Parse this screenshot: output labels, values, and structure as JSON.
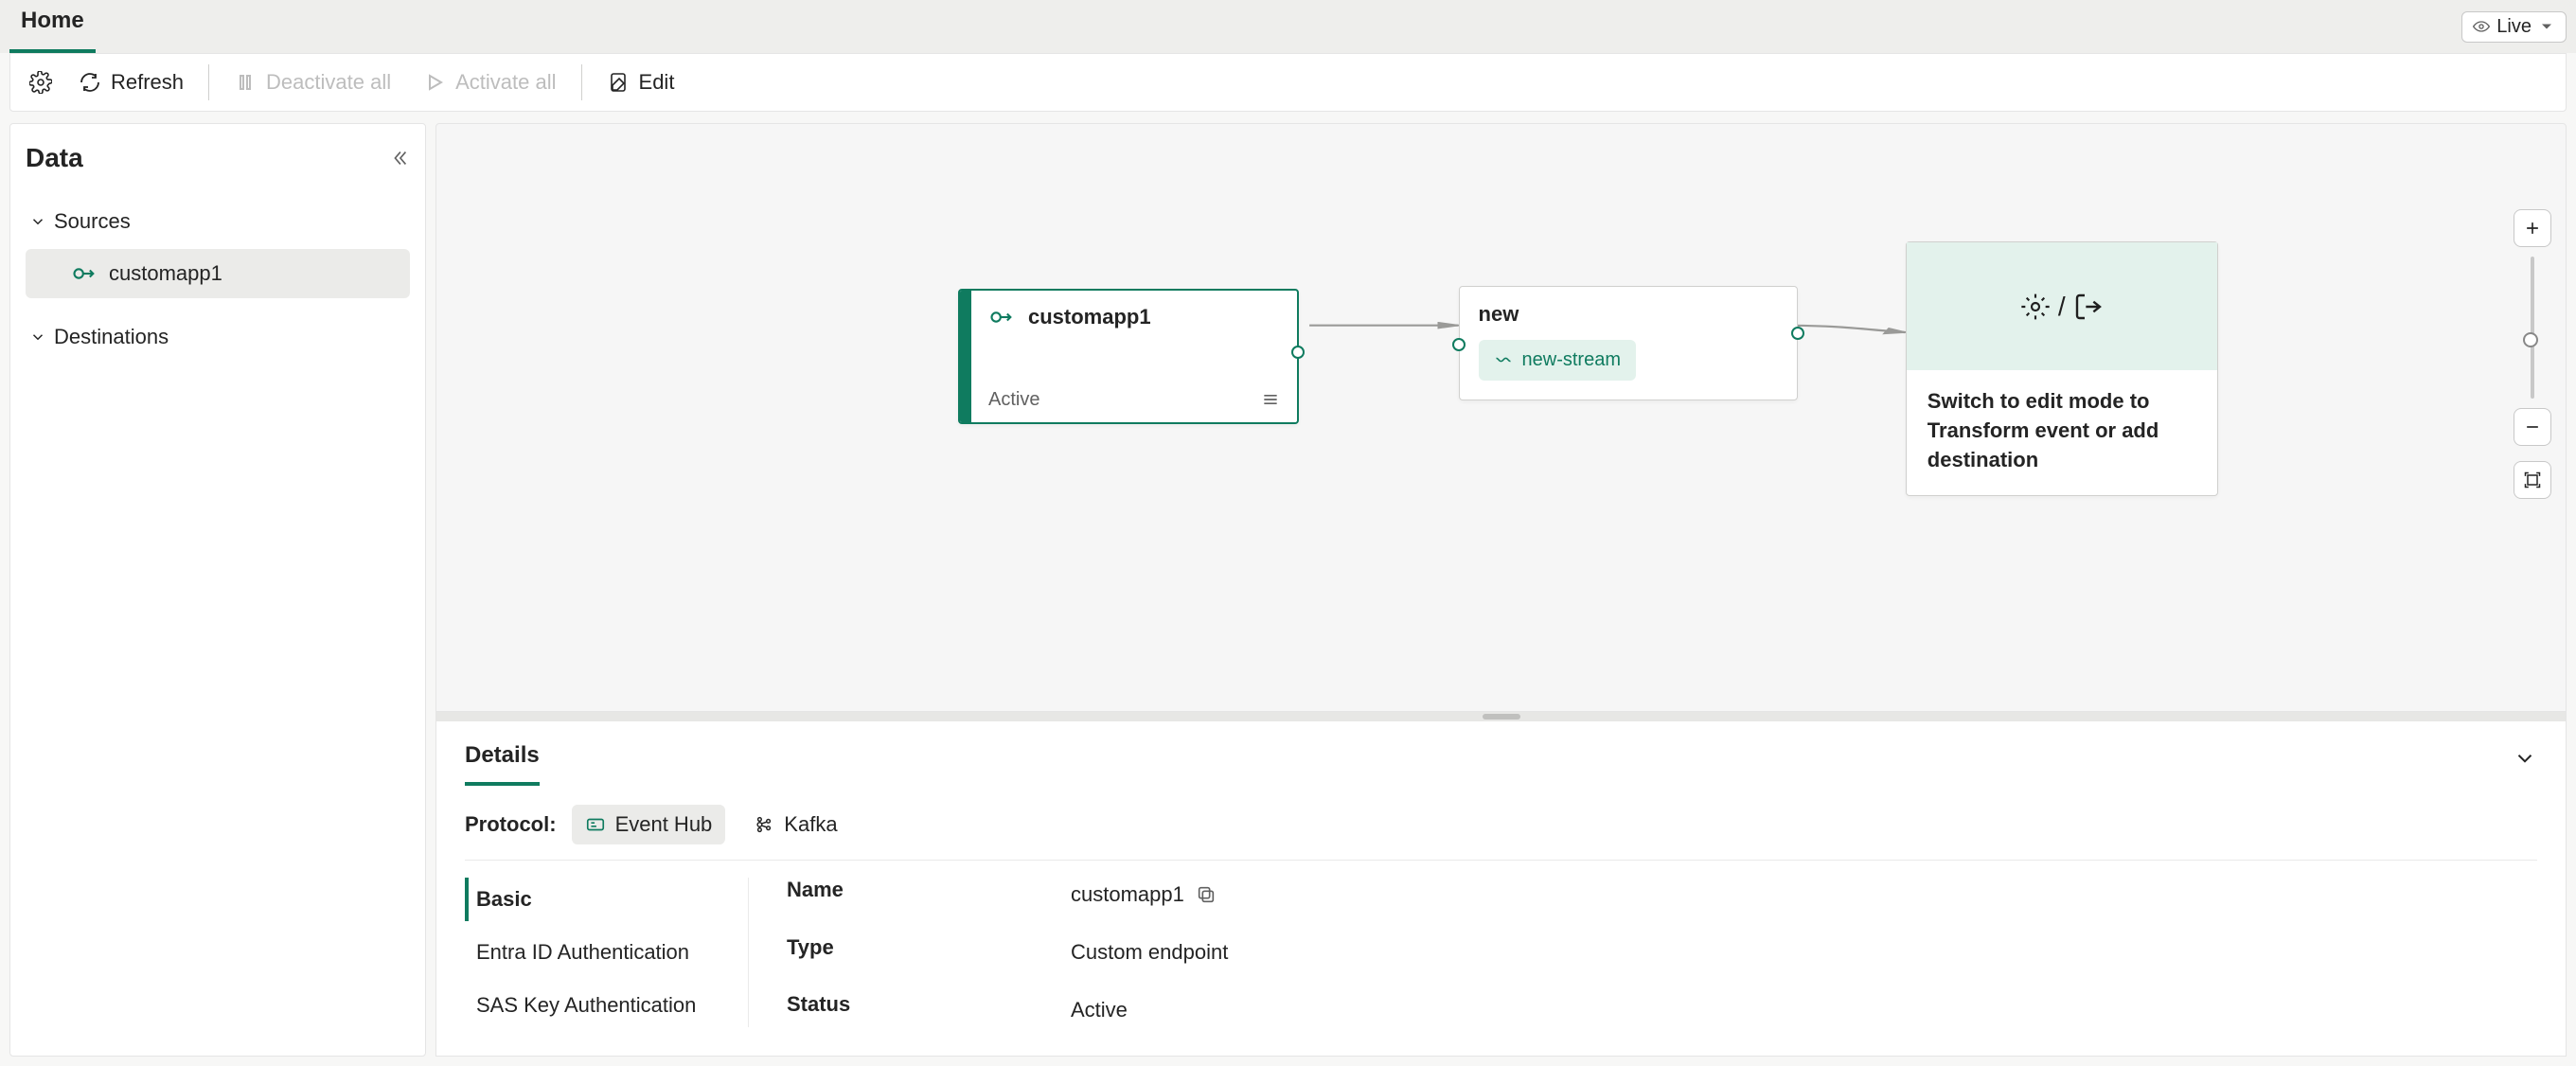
{
  "ribbon": {
    "tab": "Home"
  },
  "live": {
    "label": "Live"
  },
  "toolbar": {
    "refresh": "Refresh",
    "deactivate": "Deactivate all",
    "activate": "Activate all",
    "edit": "Edit"
  },
  "sidepanel": {
    "title": "Data",
    "sources_label": "Sources",
    "source_item": "customapp1",
    "destinations_label": "Destinations"
  },
  "nodes": {
    "source": {
      "title": "customapp1",
      "status": "Active"
    },
    "stream": {
      "title": "new",
      "chip": "new-stream"
    },
    "dest": {
      "hint": "Switch to edit mode to Transform event or add destination"
    }
  },
  "details": {
    "tab": "Details",
    "protocol_label": "Protocol:",
    "protocol_eventhub": "Event Hub",
    "protocol_kafka": "Kafka",
    "sections": {
      "basic": "Basic",
      "entra": "Entra ID Authentication",
      "sas": "SAS Key Authentication"
    },
    "props": {
      "name_label": "Name",
      "name_value": "customapp1",
      "type_label": "Type",
      "type_value": "Custom endpoint",
      "status_label": "Status",
      "status_value": "Active"
    }
  }
}
